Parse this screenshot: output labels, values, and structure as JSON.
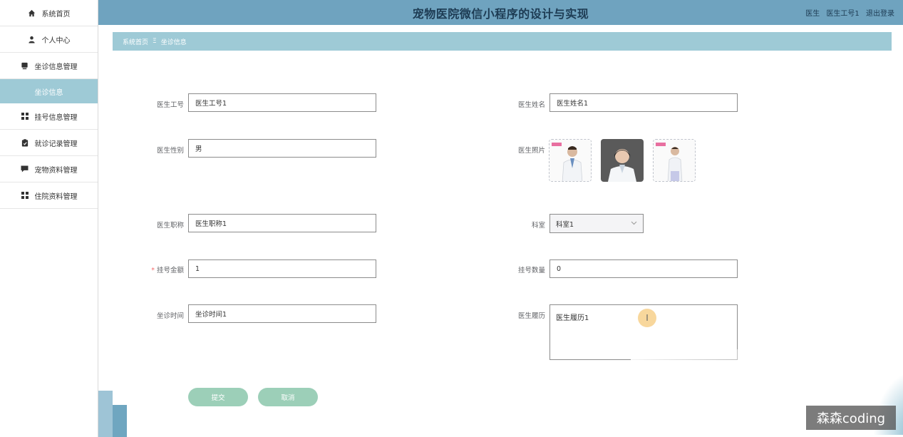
{
  "header": {
    "title": "宠物医院微信小程序的设计与实现",
    "user_role": "医生",
    "user_name": "医生工号1",
    "logout": "退出登录"
  },
  "sidebar": {
    "items": [
      {
        "label": "系统首页",
        "icon": "home-icon"
      },
      {
        "label": "个人中心",
        "icon": "user-icon"
      },
      {
        "label": "坐诊信息管理",
        "icon": "desk-icon"
      },
      {
        "label": "坐诊信息",
        "icon": ""
      },
      {
        "label": "挂号信息管理",
        "icon": "grid-icon"
      },
      {
        "label": "就诊记录管理",
        "icon": "clipboard-icon"
      },
      {
        "label": "宠物资料管理",
        "icon": "message-icon"
      },
      {
        "label": "住院资料管理",
        "icon": "grid-icon"
      }
    ]
  },
  "breadcrumb": {
    "home": "系统首页",
    "separator": "Ξ",
    "current": "坐诊信息"
  },
  "form": {
    "doctor_id": {
      "label": "医生工号",
      "value": "医生工号1"
    },
    "doctor_name": {
      "label": "医生姓名",
      "value": "医生姓名1"
    },
    "gender": {
      "label": "医生性别",
      "value": "男"
    },
    "photo": {
      "label": "医生照片"
    },
    "title": {
      "label": "医生职称",
      "value": "医生职称1"
    },
    "department": {
      "label": "科室",
      "value": "科室1"
    },
    "fee": {
      "label": "挂号金额",
      "required_mark": "*",
      "value": "1"
    },
    "quota": {
      "label": "挂号数量",
      "value": "0"
    },
    "schedule": {
      "label": "坐诊时间",
      "value": "坐诊时间1"
    },
    "resume": {
      "label": "医生履历",
      "value": "医生履历1"
    }
  },
  "buttons": {
    "submit": "提交",
    "cancel": "取消"
  },
  "overlay": {
    "cursor_glyph": "I",
    "watermark": "森森coding"
  },
  "colors": {
    "header_bg": "#6fa3bf",
    "accent": "#9ecad6",
    "button": "#9ccfb8"
  }
}
